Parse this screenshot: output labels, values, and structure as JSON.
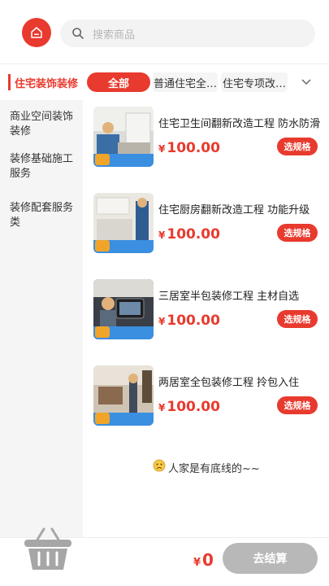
{
  "search": {
    "placeholder": "搜索商品"
  },
  "sidebar": {
    "active": "住宅装饰装修",
    "items": [
      {
        "label": "商业空间装饰装修"
      },
      {
        "label": "装修基础施工服务"
      },
      {
        "label": "装修配套服务类"
      }
    ]
  },
  "tabs": {
    "all": "全部",
    "items": [
      {
        "label": "普通住宅全…"
      },
      {
        "label": "住宅专项改…"
      }
    ]
  },
  "products": [
    {
      "name": "住宅卫生间翻新改造工程 防水防滑",
      "currency": "¥",
      "price": "100.00",
      "button": "选规格"
    },
    {
      "name": "住宅厨房翻新改造工程 功能升级",
      "currency": "¥",
      "price": "100.00",
      "button": "选规格"
    },
    {
      "name": "三居室半包装修工程 主材自选",
      "currency": "¥",
      "price": "100.00",
      "button": "选规格"
    },
    {
      "name": "两居室全包装修工程 拎包入住",
      "currency": "¥",
      "price": "100.00",
      "button": "选规格"
    }
  ],
  "end_note": "人家是有底线的~~",
  "footer": {
    "currency": "¥",
    "total": "0",
    "checkout_label": "去结算"
  },
  "colors": {
    "accent": "#e83a2e",
    "disabled": "#b8b8b8"
  }
}
